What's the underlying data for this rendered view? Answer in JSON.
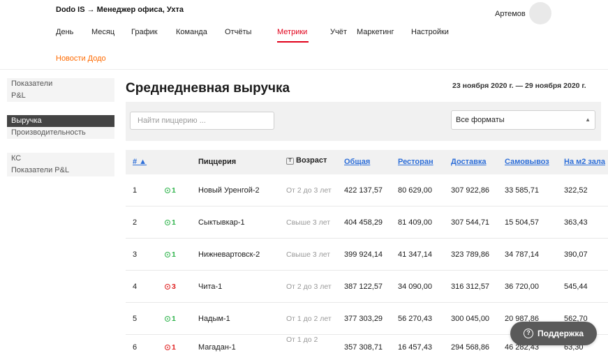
{
  "header": {
    "app_title": "Dodo IS → Менеджер офиса, Ухта",
    "user_name": "Артемов"
  },
  "nav": {
    "items": [
      "День",
      "Месяц",
      "График",
      "Команда",
      "Отчёты",
      "Метрики",
      "Учёт",
      "Маркетинг",
      "Настройки"
    ],
    "active": "Метрики",
    "news": "Новости Додо"
  },
  "sidebar": {
    "group1": [
      "Показатели",
      "P&L"
    ],
    "group2": [
      "Выручка",
      "Производительность"
    ],
    "group2_active": "Выручка",
    "group3": [
      "КС",
      "Показатели P&L"
    ]
  },
  "page": {
    "title": "Среднедневная выручка",
    "date_range": "23 ноября 2020 г. — 29 ноября 2020 г."
  },
  "filters": {
    "search_placeholder": "Найти пиццерию ...",
    "format_value": "Все форматы"
  },
  "table": {
    "headers": {
      "rank": "# ▲",
      "pizzeria": "Пиццерия",
      "filter_icon": "T",
      "age": "Возраст",
      "total": "Общая",
      "restaurant": "Ресторан",
      "delivery": "Доставка",
      "pickup": "Самовывоз",
      "per_m2": "На м2 зала"
    },
    "rows": [
      {
        "rank": "1",
        "change": "1",
        "dir": "up",
        "name": "Новый Уренгой-2",
        "age": "От 2 до 3 лет",
        "total": "422 137,57",
        "restaurant": "80 629,00",
        "delivery": "307 922,86",
        "pickup": "33 585,71",
        "per_m2": "322,52"
      },
      {
        "rank": "2",
        "change": "1",
        "dir": "up",
        "name": "Сыктывкар-1",
        "age": "Свыше 3 лет",
        "total": "404 458,29",
        "restaurant": "81 409,00",
        "delivery": "307 544,71",
        "pickup": "15 504,57",
        "per_m2": "363,43"
      },
      {
        "rank": "3",
        "change": "1",
        "dir": "up",
        "name": "Нижневартовск-2",
        "age": "Свыше 3 лет",
        "total": "399 924,14",
        "restaurant": "41 347,14",
        "delivery": "323 789,86",
        "pickup": "34 787,14",
        "per_m2": "390,07"
      },
      {
        "rank": "4",
        "change": "3",
        "dir": "down",
        "name": "Чита-1",
        "age": "От 2 до 3 лет",
        "total": "387 122,57",
        "restaurant": "34 090,00",
        "delivery": "316 312,57",
        "pickup": "36 720,00",
        "per_m2": "545,44"
      },
      {
        "rank": "5",
        "change": "1",
        "dir": "up",
        "name": "Надым-1",
        "age": "От 1 до 2 лет",
        "total": "377 303,29",
        "restaurant": "56 270,43",
        "delivery": "300 045,00",
        "pickup": "20 987,86",
        "per_m2": "562,70"
      },
      {
        "rank": "6",
        "change": "1",
        "dir": "down",
        "name": "Магадан-1",
        "age": "От 1 до 2",
        "total": "357 308,71",
        "restaurant": "16 457,43",
        "delivery": "294 568,86",
        "pickup": "46 282,43",
        "per_m2": "63,30"
      }
    ]
  },
  "support": {
    "label": "Поддержка",
    "icon": "?"
  },
  "colors": {
    "accent": "#e1001a",
    "news": "#ff6a00",
    "link": "#2d6ed8",
    "up": "#2db34a",
    "down": "#e02020"
  }
}
